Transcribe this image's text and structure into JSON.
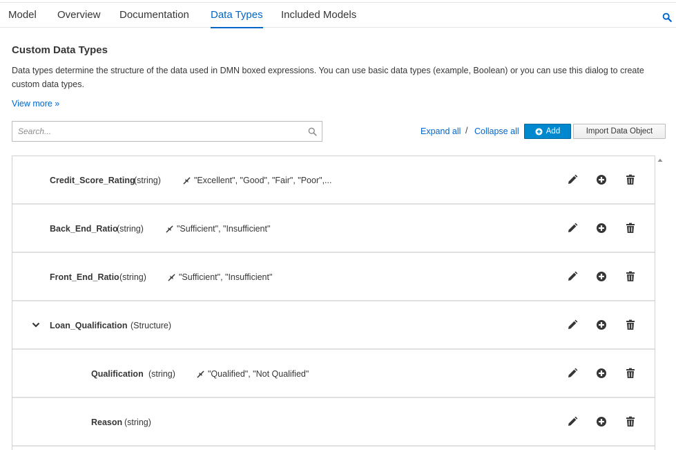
{
  "tabs": [
    {
      "label": "Model",
      "active": false
    },
    {
      "label": "Overview",
      "active": false
    },
    {
      "label": "Documentation",
      "active": false
    },
    {
      "label": "Data Types",
      "active": true
    },
    {
      "label": "Included Models",
      "active": false
    }
  ],
  "header": {
    "title": "Custom Data Types",
    "description": "Data types determine the structure of the data used in DMN boxed expressions. You can use basic data types (example, Boolean) or you can use this dialog to create custom data types.",
    "view_more": "View more »"
  },
  "toolbar": {
    "search_placeholder": "Search...",
    "expand_all": "Expand all",
    "separator": "/",
    "collapse_all": "Collapse all",
    "add_label": "Add",
    "import_label": "Import Data Object"
  },
  "rows": [
    {
      "name": "Credit_Score_Rating",
      "type": "(string)",
      "constraint": "\"Excellent\", \"Good\", \"Fair\", \"Poor\",..."
    },
    {
      "name": "Back_End_Ratio",
      "type": "(string)",
      "constraint": "\"Sufficient\", \"Insufficient\""
    },
    {
      "name": "Front_End_Ratio",
      "type": "(string)",
      "constraint": "\"Sufficient\", \"Insufficient\""
    },
    {
      "name": "Loan_Qualification",
      "type": "(Structure)",
      "constraint": "",
      "expanded": true
    },
    {
      "name": "Qualification",
      "type": "(string)",
      "constraint": "\"Qualified\", \"Not Qualified\""
    },
    {
      "name": "Reason",
      "type": "(string)",
      "constraint": ""
    }
  ],
  "icons": {
    "search": "search-icon",
    "constraint": "constraint-icon",
    "edit": "pencil-icon",
    "add_child": "plus-circle-icon",
    "delete": "trash-icon",
    "expand": "chevron-down-icon"
  },
  "colors": {
    "accent": "#0066cc",
    "button_primary": "#0088ce",
    "text": "#363636"
  }
}
